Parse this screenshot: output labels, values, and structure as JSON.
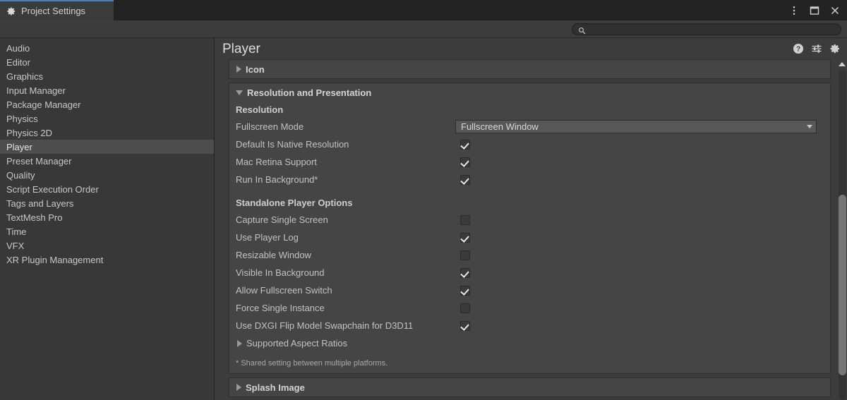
{
  "window": {
    "tab_label": "Project Settings",
    "tab_icon": "gear-icon",
    "controls": [
      {
        "name": "more-options-button",
        "icon": "kebab-menu-icon"
      },
      {
        "name": "maximize-button",
        "icon": "maximize-icon"
      },
      {
        "name": "close-button",
        "icon": "close-icon"
      }
    ]
  },
  "search": {
    "icon": "search-icon",
    "value": "",
    "placeholder": ""
  },
  "sidebar": {
    "items": [
      {
        "label": "Audio",
        "selected": false
      },
      {
        "label": "Editor",
        "selected": false
      },
      {
        "label": "Graphics",
        "selected": false
      },
      {
        "label": "Input Manager",
        "selected": false
      },
      {
        "label": "Package Manager",
        "selected": false
      },
      {
        "label": "Physics",
        "selected": false
      },
      {
        "label": "Physics 2D",
        "selected": false
      },
      {
        "label": "Player",
        "selected": true
      },
      {
        "label": "Preset Manager",
        "selected": false
      },
      {
        "label": "Quality",
        "selected": false
      },
      {
        "label": "Script Execution Order",
        "selected": false
      },
      {
        "label": "Tags and Layers",
        "selected": false
      },
      {
        "label": "TextMesh Pro",
        "selected": false
      },
      {
        "label": "Time",
        "selected": false
      },
      {
        "label": "VFX",
        "selected": false
      },
      {
        "label": "XR Plugin Management",
        "selected": false
      }
    ]
  },
  "pane": {
    "title": "Player",
    "header_icons": [
      {
        "name": "help-icon",
        "label": "?"
      },
      {
        "name": "preset-icon",
        "label": ""
      },
      {
        "name": "gear-icon",
        "label": ""
      }
    ],
    "sections": {
      "icon": {
        "title": "Icon",
        "expanded": false
      },
      "resolution_presentation": {
        "title": "Resolution and Presentation",
        "expanded": true,
        "resolution_group_label": "Resolution",
        "fullscreen_mode": {
          "label": "Fullscreen Mode",
          "value": "Fullscreen Window"
        },
        "resolution_checkboxes": [
          {
            "label": "Default Is Native Resolution",
            "checked": true
          },
          {
            "label": "Mac Retina Support",
            "checked": true
          },
          {
            "label": "Run In Background*",
            "checked": true
          }
        ],
        "standalone_group_label": "Standalone Player Options",
        "standalone_checkboxes": [
          {
            "label": "Capture Single Screen",
            "checked": false
          },
          {
            "label": "Use Player Log",
            "checked": true
          },
          {
            "label": "Resizable Window",
            "checked": false
          },
          {
            "label": "Visible In Background",
            "checked": true
          },
          {
            "label": "Allow Fullscreen Switch",
            "checked": true
          },
          {
            "label": "Force Single Instance",
            "checked": false
          },
          {
            "label": "Use DXGI Flip Model Swapchain for D3D11",
            "checked": true
          }
        ],
        "supported_aspect_ratios": {
          "title": "Supported Aspect Ratios",
          "expanded": false
        },
        "footnote": "* Shared setting between multiple platforms."
      },
      "splash_image": {
        "title": "Splash Image",
        "expanded": false
      }
    }
  },
  "colors": {
    "window_chrome": "#232323",
    "toolbar": "#3c3c3c",
    "sidebar_bg": "#383838",
    "sidebar_selected": "#4d4d4d",
    "panel_bg": "#3c3c3c",
    "foldout_bg": "#454545",
    "dropdown_bg": "#585858",
    "tab_accent": "#4e7fb8",
    "text_primary": "#d2d2d2",
    "text_secondary": "#c2c2c2",
    "scroll_thumb": "#767676"
  }
}
